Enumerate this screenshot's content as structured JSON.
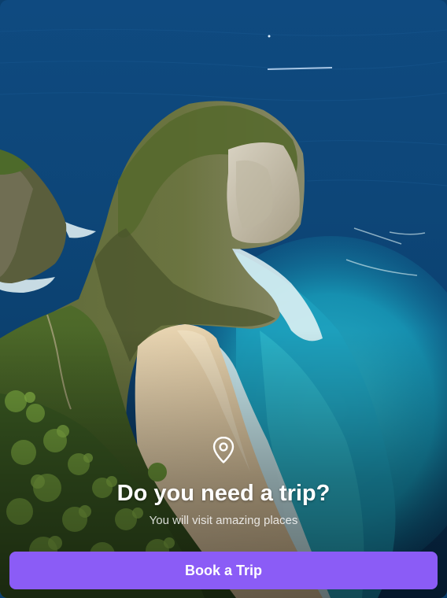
{
  "hero": {
    "icon": "map-pin-icon",
    "title": "Do you need a trip?",
    "subtitle": "You will visit amazing places"
  },
  "cta": {
    "label": "Book a Trip",
    "color": "#8b5cf6"
  }
}
